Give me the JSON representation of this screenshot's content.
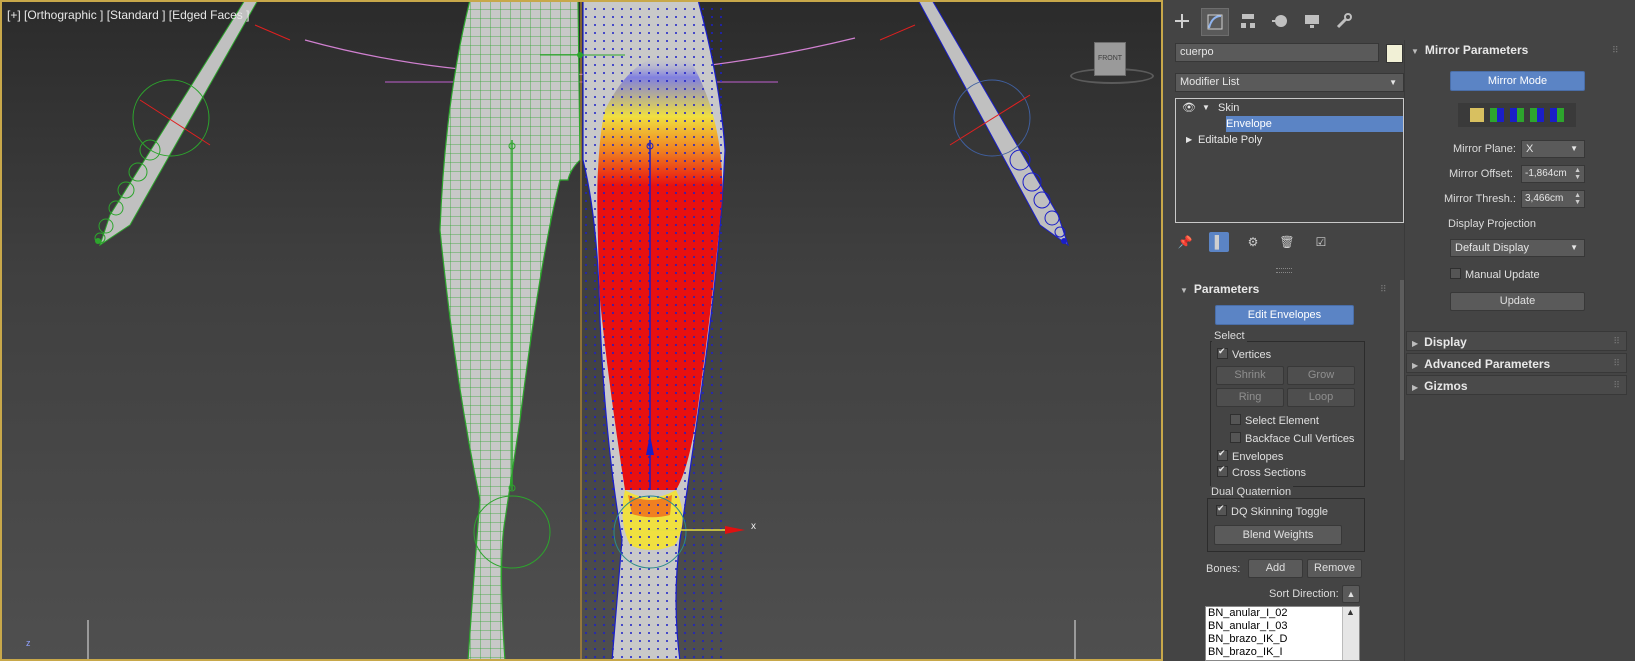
{
  "viewport": {
    "label": "[+] [Orthographic ] [Standard ] [Edged Faces ]",
    "viewcube_label": "FRONT",
    "gizmo_axis_x": "x",
    "axis_z": "z"
  },
  "command_panel": {
    "tabs": [
      "create",
      "modify",
      "hierarchy",
      "motion",
      "display",
      "utilities"
    ],
    "active_tab": "modify",
    "object_name": "cuerpo",
    "object_color": "#f1f0d6",
    "modifier_list": "Modifier List",
    "stack": [
      {
        "label": "Skin"
      },
      {
        "label": "Envelope"
      },
      {
        "label": "Editable Poly"
      }
    ]
  },
  "parameters": {
    "title": "Parameters",
    "edit_envelopes": "Edit Envelopes",
    "select_group": "Select",
    "vertices": "Vertices",
    "shrink": "Shrink",
    "grow": "Grow",
    "ring": "Ring",
    "loop": "Loop",
    "select_element": "Select Element",
    "backface_cull": "Backface Cull Vertices",
    "envelopes": "Envelopes",
    "cross_sections": "Cross Sections",
    "dual_quat_group": "Dual Quaternion",
    "dq_toggle": "DQ Skinning Toggle",
    "blend_weights": "Blend Weights",
    "bones_label": "Bones:",
    "add": "Add",
    "remove": "Remove",
    "sort_direction": "Sort Direction:",
    "bones": [
      "BN_anular_I_02",
      "BN_anular_I_03",
      "BN_brazo_IK_D",
      "BN_brazo_IK_I"
    ]
  },
  "mirror": {
    "title": "Mirror Parameters",
    "mirror_mode": "Mirror Mode",
    "plane_label": "Mirror Plane:",
    "plane_value": "X",
    "offset_label": "Mirror Offset:",
    "offset_value": "-1,864cm",
    "thresh_label": "Mirror Thresh.:",
    "thresh_value": "3,466cm",
    "display_projection": "Display Projection",
    "default_display": "Default Display",
    "manual_update": "Manual Update",
    "update": "Update"
  },
  "rollouts": [
    "Display",
    "Advanced Parameters",
    "Gizmos"
  ]
}
